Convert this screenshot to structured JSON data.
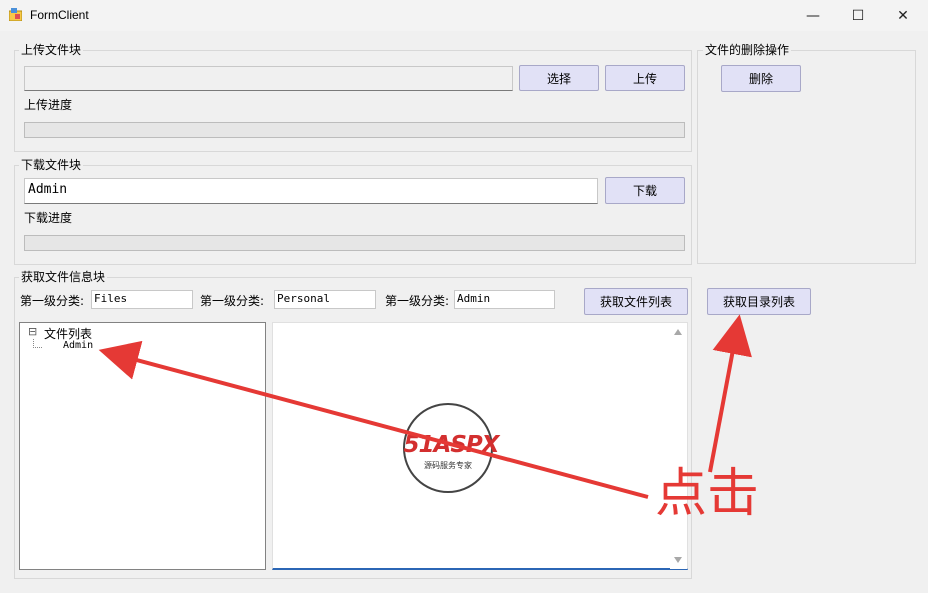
{
  "window": {
    "title": "FormClient",
    "min_glyph": "—",
    "max_glyph": "☐",
    "close_glyph": "✕"
  },
  "upload": {
    "legend": "上传文件块",
    "path_value": "",
    "select_label": "选择",
    "upload_label": "上传",
    "progress_label": "上传进度",
    "progress": 0
  },
  "download": {
    "legend": "下载文件块",
    "path_value": "Admin",
    "download_label": "下载",
    "progress_label": "下载进度",
    "progress": 0
  },
  "delete_group": {
    "legend": "文件的删除操作",
    "delete_label": "删除"
  },
  "info": {
    "legend": "获取文件信息块",
    "cat1_label": "第一级分类:",
    "cat1_value": "Files",
    "cat2_label": "第一级分类:",
    "cat2_value": "Personal",
    "cat3_label": "第一级分类:",
    "cat3_value": "Admin",
    "get_files_label": "获取文件列表",
    "get_dirs_label": "获取目录列表",
    "tree_root_label": "文件列表",
    "tree_expand_glyph": "⊟",
    "tree_child_label": "Admin"
  },
  "watermark": {
    "brand": "51ASPX",
    "tagline": "源码服务专家"
  },
  "annotation": {
    "text": "点击",
    "color": "#e53935"
  }
}
